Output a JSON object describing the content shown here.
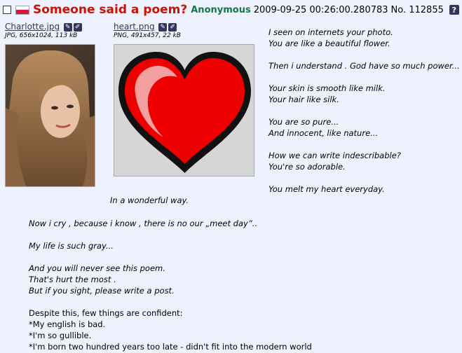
{
  "post": {
    "subject": "Someone said a poem?",
    "name": "Anonymous",
    "datetime": "2009-09-25 00:26:00.280783",
    "number": "No. 112855",
    "help_icon_label": "?"
  },
  "files": [
    {
      "filename": "Charlotte.jpg",
      "info": "JPG, 656x1024, 113 kB"
    },
    {
      "filename": "heart.png",
      "info": "PNG, 491x457, 22 kB"
    }
  ],
  "poem_lines": [
    "I seen on internets your photo.",
    "You are like a beautiful flower.",
    "",
    "Then i understand . God have so much power...",
    "",
    "Your skin is smooth like milk.",
    "Your hair like silk.",
    "",
    "You are so pure...",
    "And innocent, like nature...",
    "",
    "How we can write indescribable?",
    "You're so adorable.",
    "",
    "You melt my heart everyday."
  ],
  "wonderful_line": "In a wonderful way.",
  "italic_lines": [
    "Now i cry , because i know , there is no our „meet day”..",
    "",
    "My life is such gray...",
    "",
    "And you will never see this poem.",
    "That's hurt the most .",
    "But if you sight, please write a post."
  ],
  "plain_lines": [
    "Despite this, few things are confident:",
    "*My english is bad.",
    "*I'm so gullible.",
    "*I'm born two hundred years too late - didn't fit into the modern world"
  ],
  "colors": {
    "subject": "#cc1105",
    "name": "#117743",
    "background": "#eef2ff",
    "heart": "#ee0000"
  }
}
